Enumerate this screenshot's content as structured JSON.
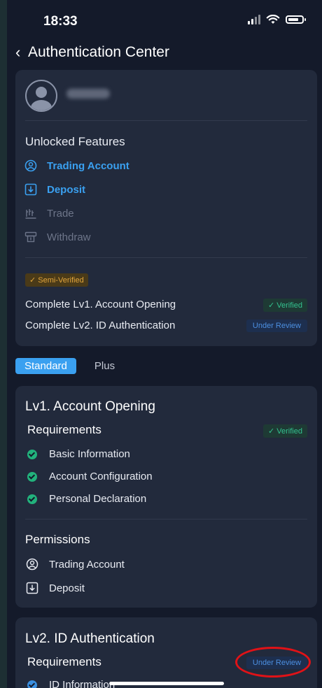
{
  "status_bar": {
    "time": "18:33"
  },
  "nav": {
    "title": "Authentication Center"
  },
  "features": {
    "title": "Unlocked Features",
    "items": [
      {
        "label": "Trading Account",
        "icon": "user-circle-icon",
        "unlocked": true
      },
      {
        "label": "Deposit",
        "icon": "deposit-icon",
        "unlocked": true
      },
      {
        "label": "Trade",
        "icon": "chart-icon",
        "unlocked": false
      },
      {
        "label": "Withdraw",
        "icon": "withdraw-icon",
        "unlocked": false
      }
    ]
  },
  "status": {
    "badge": "Semi-Verified",
    "rows": [
      {
        "label": "Complete Lv1. Account Opening",
        "state": "Verified"
      },
      {
        "label": "Complete Lv2. ID Authentication",
        "state": "Under Review"
      }
    ]
  },
  "tabs": {
    "standard": "Standard",
    "plus": "Plus"
  },
  "lv1": {
    "title": "Lv1. Account Opening",
    "requirements_label": "Requirements",
    "state": "Verified",
    "requirements": [
      "Basic Information",
      "Account Configuration",
      "Personal Declaration"
    ],
    "permissions_label": "Permissions",
    "permissions": [
      "Trading Account",
      "Deposit"
    ]
  },
  "lv2": {
    "title": "Lv2. ID Authentication",
    "requirements_label": "Requirements",
    "state": "Under Review",
    "requirements": [
      "ID Information"
    ]
  },
  "colors": {
    "accent": "#3aa0f0",
    "verified": "#33c28f",
    "review": "#4c8fe0",
    "warning": "#e2a53b",
    "highlight_ring": "#e01217"
  }
}
